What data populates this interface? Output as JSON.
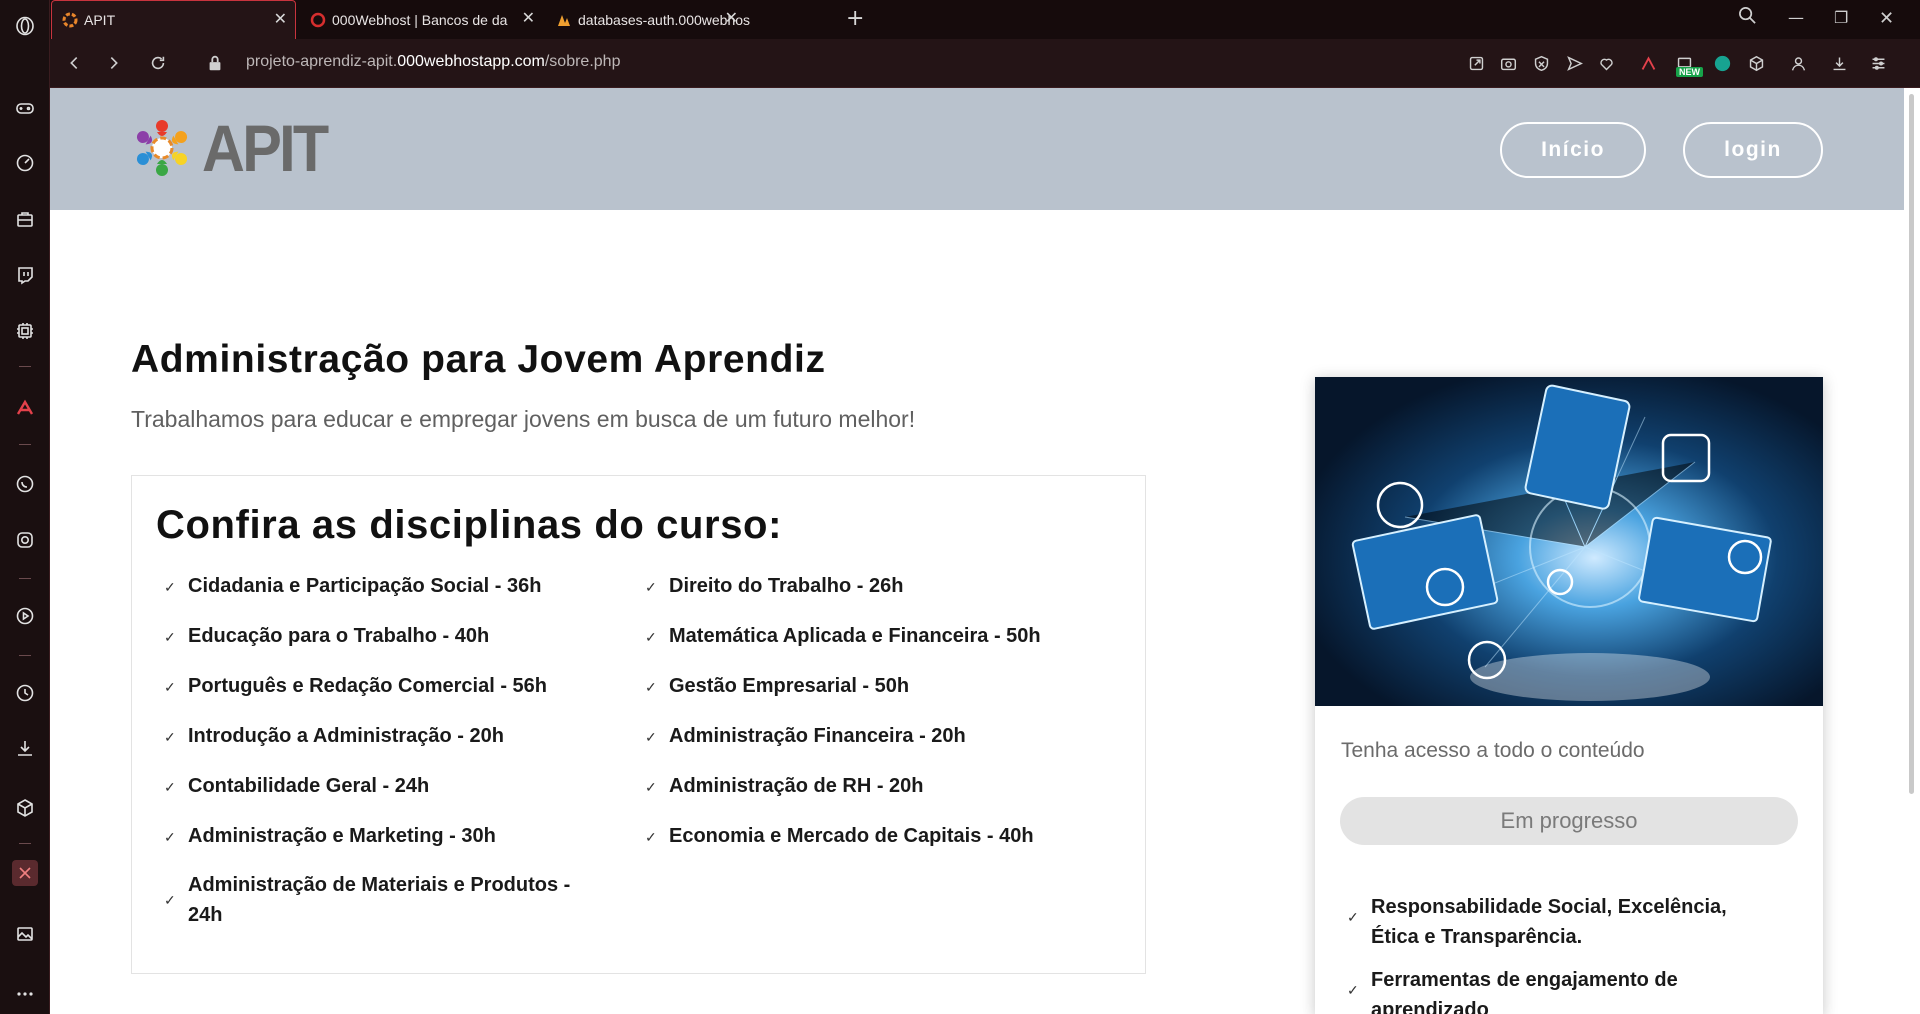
{
  "browser": {
    "tabs": [
      {
        "title": "APIT",
        "active": true
      },
      {
        "title": "000Webhost | Bancos de da",
        "active": false
      },
      {
        "title": "databases-auth.000webhos",
        "active": false
      }
    ],
    "url_prefix": "projeto-aprendiz-apit.",
    "url_domain": "000webhostapp.com",
    "url_path": "/sobre.php",
    "new_badge": "NEW",
    "accent_color": "#c8343e"
  },
  "site": {
    "logo_text": "APIT",
    "nav": {
      "inicio": "Início",
      "login": "login"
    },
    "header_bg": "#b9c2cd"
  },
  "hero": {
    "title": "Administração para Jovem Aprendiz",
    "subtitle": "Trabalhamos para educar e empregar jovens em busca de um futuro melhor!"
  },
  "course": {
    "title": "Confira as disciplinas do curso:",
    "left": [
      "Cidadania e Participação Social - 36h",
      "Educação para o Trabalho - 40h",
      "Português e Redação Comercial - 56h",
      "Introdução a Administração - 20h",
      "Contabilidade Geral - 24h",
      "Administração e Marketing - 30h",
      "Administração de Materiais e Produtos - 24h"
    ],
    "right": [
      "Direito do Trabalho - 26h",
      "Matemática Aplicada e Financeira - 50h",
      "Gestão Empresarial - 50h",
      "Administração Financeira - 20h",
      "Administração de RH - 20h",
      "Economia e Mercado de Capitais - 40h"
    ]
  },
  "card": {
    "text": "Tenha acesso a todo o conteúdo",
    "button": "Em progresso",
    "items": [
      "Responsabilidade Social, Excelência, Ética e Transparência.",
      "Ferramentas de engajamento de aprendizado"
    ]
  }
}
